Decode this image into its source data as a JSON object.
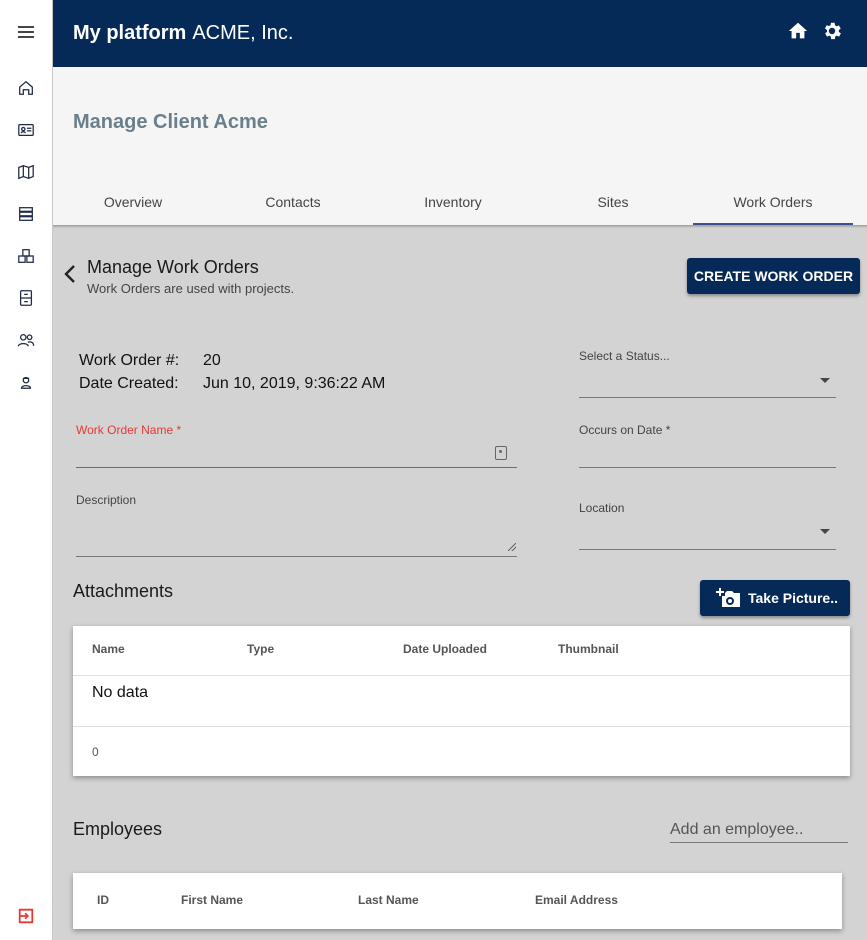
{
  "header": {
    "brand_bold": "My platform",
    "brand_light": "ACME, Inc.",
    "home_icon": "home-icon",
    "settings_icon": "gear-icon",
    "color": "#062a57"
  },
  "sidebar": {
    "items": [
      {
        "icon": "menu-icon"
      },
      {
        "icon": "home-icon"
      },
      {
        "icon": "contact-card-icon"
      },
      {
        "icon": "map-icon"
      },
      {
        "icon": "inventory-icon"
      },
      {
        "icon": "boxes-icon"
      },
      {
        "icon": "cabinet-icon"
      },
      {
        "icon": "users-icon"
      },
      {
        "icon": "worker-icon"
      },
      {
        "icon": "exit-icon"
      }
    ]
  },
  "page": {
    "title": "Manage Client Acme",
    "tabs": [
      {
        "label": "Overview"
      },
      {
        "label": "Contacts"
      },
      {
        "label": "Inventory"
      },
      {
        "label": "Sites"
      },
      {
        "label": "Work Orders",
        "active": true
      }
    ]
  },
  "work_orders": {
    "title": "Manage Work Orders",
    "subtitle": "Work Orders are used with projects.",
    "create_button": "CREATE WORK ORDER",
    "number_label": "Work Order #:",
    "number_value": "20",
    "date_label": "Date Created:",
    "date_value": "Jun 10, 2019, 9:36:22 AM"
  },
  "form": {
    "status_label": "Select a Status...",
    "name_label": "Work Order Name *",
    "occurs_label": "Occurs on Date *",
    "description_label": "Description",
    "location_label": "Location"
  },
  "attachments": {
    "title": "Attachments",
    "take_picture_button": "Take Picture..",
    "columns": [
      "Name",
      "Type",
      "Date Uploaded",
      "Thumbnail"
    ],
    "empty_text": "No data",
    "count": "0"
  },
  "employees": {
    "title": "Employees",
    "add_placeholder": "Add an employee..",
    "columns": [
      "ID",
      "First Name",
      "Last Name",
      "Email Address"
    ]
  }
}
